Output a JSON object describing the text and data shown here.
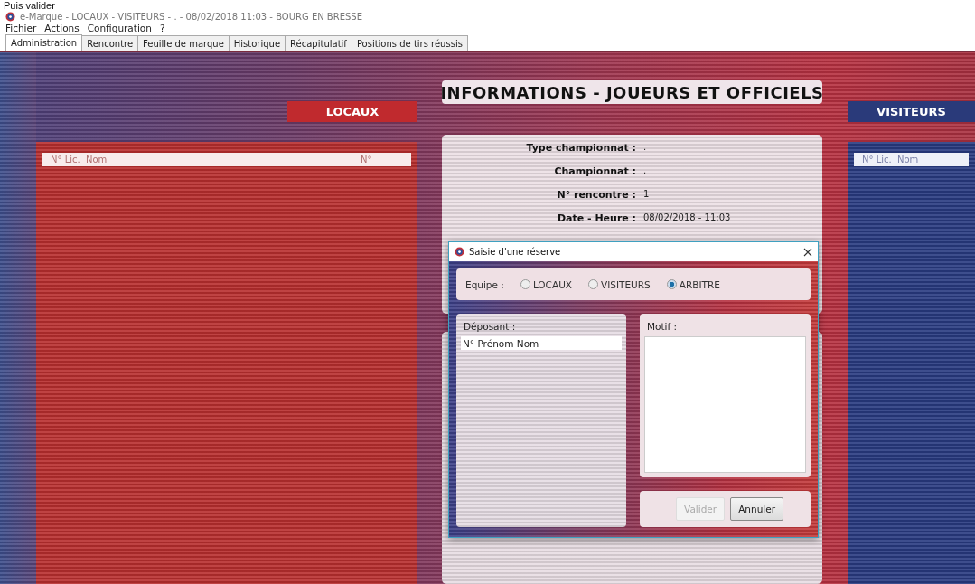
{
  "caption": "Puis valider",
  "window": {
    "title": "e-Marque - LOCAUX - VISITEURS - . - 08/02/2018 11:03 - BOURG EN BRESSE"
  },
  "menu": [
    "Fichier",
    "Actions",
    "Configuration",
    "?"
  ],
  "tabs": [
    {
      "label": "Administration",
      "selected": true
    },
    {
      "label": "Rencontre",
      "selected": false
    },
    {
      "label": "Feuille de marque",
      "selected": false
    },
    {
      "label": "Historique",
      "selected": false
    },
    {
      "label": "Récapitulatif",
      "selected": false
    },
    {
      "label": "Positions de tirs réussis",
      "selected": false
    }
  ],
  "home": {
    "label": "LOCAUX",
    "columns": [
      "N° Lic.",
      "Nom",
      "N°"
    ]
  },
  "away": {
    "label": "VISITEURS",
    "columns": [
      "N° Lic.",
      "Nom"
    ]
  },
  "info": {
    "title": "INFORMATIONS - JOUEURS ET OFFICIELS",
    "fields": [
      {
        "label": "Type championnat :",
        "value": "."
      },
      {
        "label": "Championnat :",
        "value": "."
      },
      {
        "label": "N° rencontre :",
        "value": "1"
      },
      {
        "label": "Date - Heure :",
        "value": "08/02/2018 - 11:03"
      }
    ]
  },
  "dialog": {
    "title": "Saisie d'une réserve",
    "team_label": "Equipe :",
    "team_options": [
      {
        "label": "LOCAUX",
        "selected": false
      },
      {
        "label": "VISITEURS",
        "selected": false
      },
      {
        "label": "ARBITRE",
        "selected": true
      }
    ],
    "depositor_label": "Déposant :",
    "depositor_header": "N° Prénom Nom",
    "reason_label": "Motif :",
    "buttons": [
      {
        "label": "Valider",
        "disabled": true
      },
      {
        "label": "Annuler",
        "disabled": false
      }
    ]
  }
}
